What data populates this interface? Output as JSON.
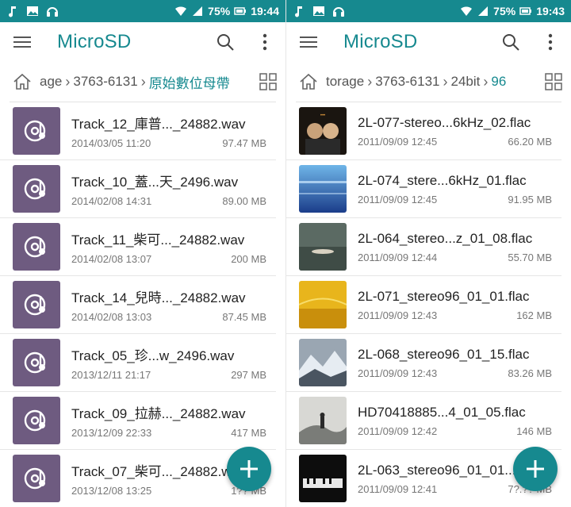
{
  "colors": {
    "accent": "#16898f",
    "audio_thumb": "#6e5b80"
  },
  "left": {
    "status": {
      "battery": "75%",
      "time": "19:44"
    },
    "title": "MicroSD",
    "crumbs": [
      "age",
      "3763-6131",
      "原始數位母帶"
    ],
    "files": [
      {
        "name": "Track_12_庫普..._24882.wav",
        "date": "2014/03/05 11:20",
        "size": "97.47 MB"
      },
      {
        "name": "Track_10_蓋...天_2496.wav",
        "date": "2014/02/08 14:31",
        "size": "89.00 MB"
      },
      {
        "name": "Track_11_柴可..._24882.wav",
        "date": "2014/02/08 13:07",
        "size": "200 MB"
      },
      {
        "name": "Track_14_兒時..._24882.wav",
        "date": "2014/02/08 13:03",
        "size": "87.45 MB"
      },
      {
        "name": "Track_05_珍...w_2496.wav",
        "date": "2013/12/11 21:17",
        "size": "297 MB"
      },
      {
        "name": "Track_09_拉赫..._24882.wav",
        "date": "2013/12/09 22:33",
        "size": "417 MB"
      },
      {
        "name": "Track_07_柴可..._24882.wav",
        "date": "2013/12/08 13:25",
        "size": "1?? MB"
      }
    ]
  },
  "right": {
    "status": {
      "battery": "75%",
      "time": "19:43"
    },
    "title": "MicroSD",
    "crumbs": [
      "torage",
      "3763-6131",
      "24bit",
      "96"
    ],
    "files": [
      {
        "name": "2L-077-stereo...6kHz_02.flac",
        "date": "2011/09/09 12:45",
        "size": "66.20 MB",
        "art": "duo"
      },
      {
        "name": "2L-074_stere...6kHz_01.flac",
        "date": "2011/09/09 12:45",
        "size": "91.95 MB",
        "art": "crystal"
      },
      {
        "name": "2L-064_stereo...z_01_08.flac",
        "date": "2011/09/09 12:44",
        "size": "55.70 MB",
        "art": "lake"
      },
      {
        "name": "2L-071_stereo96_01_01.flac",
        "date": "2011/09/09 12:43",
        "size": "162 MB",
        "art": "gold"
      },
      {
        "name": "2L-068_stereo96_01_15.flac",
        "date": "2011/09/09 12:43",
        "size": "83.26 MB",
        "art": "ice"
      },
      {
        "name": "HD70418885...4_01_05.flac",
        "date": "2011/09/09 12:42",
        "size": "146 MB",
        "art": "wanderer"
      },
      {
        "name": "2L-063_stereo96_01_01....",
        "date": "2011/09/09 12:41",
        "size": "7?.?? MB",
        "art": "piano"
      }
    ]
  }
}
